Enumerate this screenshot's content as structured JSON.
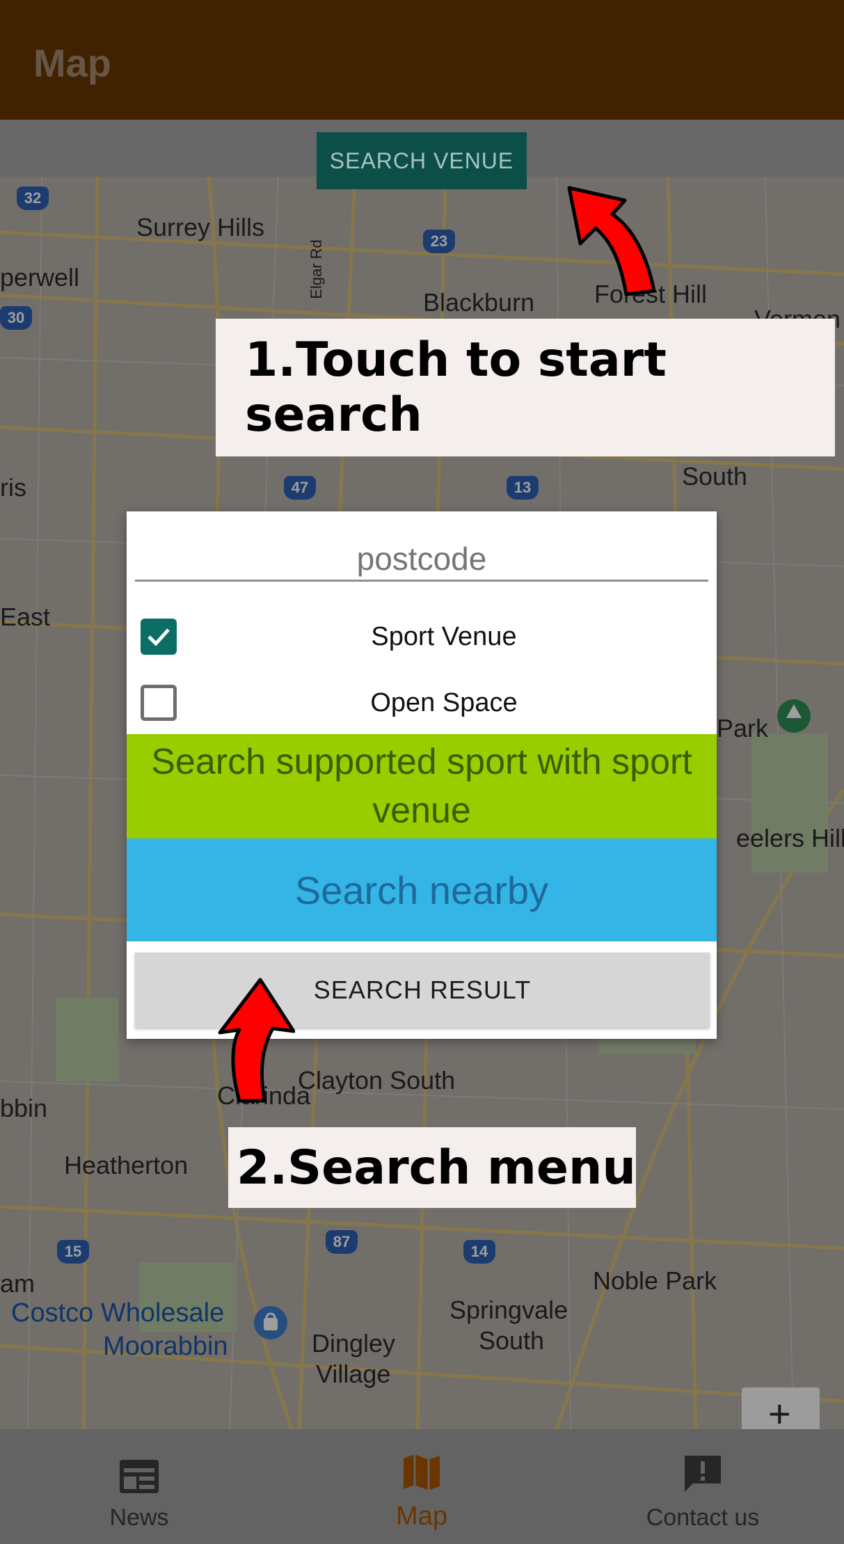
{
  "appbar": {
    "title": "Map"
  },
  "toolbar": {
    "search_venue_label": "SEARCH VENUE"
  },
  "map": {
    "labels": {
      "surrey_hills": "Surrey Hills",
      "blackburn": "Blackburn",
      "forest_hill": "Forest Hill",
      "camberwell": "perwell",
      "elgar_rd": "Elgar Rd",
      "vermont": "Vermon",
      "south": "South",
      "ris": "ris",
      "east": "East",
      "park": "Park",
      "wheelers_hill": "eelers Hill",
      "clayton_south": "Clayton South",
      "clarinda": "Clarinda",
      "moorabbin_left": "bbin",
      "heatherton": "Heatherton",
      "noble_park": "Noble Park",
      "am": "am",
      "costco_line1": "Costco Wholesale",
      "costco_line2": "Moorabbin",
      "springvale_line1": "Springvale",
      "springvale_line2": "South",
      "dingley_line1": "Dingley",
      "dingley_line2": "Village"
    },
    "shields": [
      "32",
      "23",
      "30",
      "47",
      "13",
      "15",
      "87",
      "14"
    ],
    "zoom_in_label": "+"
  },
  "callouts": {
    "step1": "1.Touch to start search",
    "step2": "2.Search menu"
  },
  "dialog": {
    "postcode_placeholder": "postcode",
    "sport_venue_label": "Sport Venue",
    "sport_venue_checked": true,
    "open_space_label": "Open Space",
    "open_space_checked": false,
    "supported_sport_label": "Search supported sport with sport venue",
    "nearby_label": "Search nearby",
    "result_label": "SEARCH RESULT"
  },
  "bottom_nav": {
    "items": [
      {
        "label": "News",
        "icon": "news-icon"
      },
      {
        "label": "Map",
        "icon": "map-icon",
        "active": true
      },
      {
        "label": "Contact us",
        "icon": "chat-alert-icon"
      }
    ]
  },
  "colors": {
    "appbar": "#693700",
    "accent": "#0b6e64",
    "sport_button": "#9acd00",
    "nearby_button": "#34b5e6",
    "active_nav": "#6b3500"
  }
}
